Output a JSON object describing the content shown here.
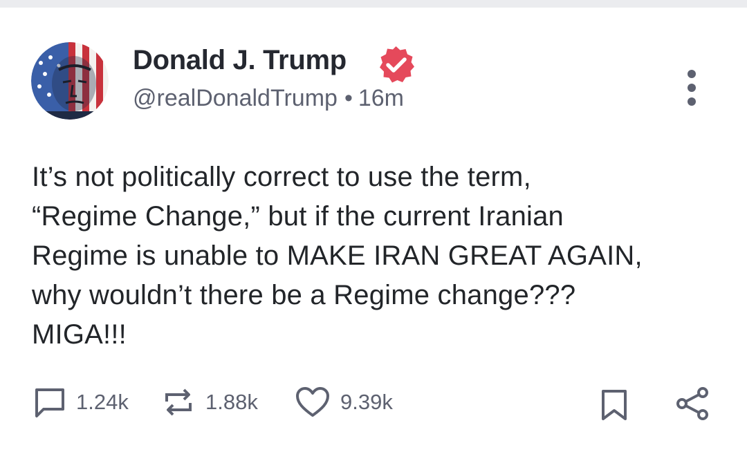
{
  "post": {
    "author": {
      "display_name": "Donald J. Trump",
      "handle": "@realDonaldTrump",
      "verified": true,
      "avatar_icon": "avatar-flag-portrait"
    },
    "separator": "•",
    "time_ago": "16m",
    "text_lines": [
      "It’s not politically correct to use the term,",
      "“Regime Change,” but if the current Iranian",
      "Regime is unable to MAKE IRAN GREAT AGAIN,",
      "why wouldn’t there be a Regime change???",
      "MIGA!!!"
    ],
    "actions": {
      "replies": "1.24k",
      "reposts": "1.88k",
      "likes": "9.39k"
    }
  },
  "icons": {
    "verified": "verified-badge-icon",
    "more": "more-vertical-icon",
    "reply": "comment-icon",
    "repost": "repost-icon",
    "like": "heart-icon",
    "bookmark": "bookmark-icon",
    "share": "share-icon"
  },
  "colors": {
    "verified_badge": "#e5495b",
    "text_primary": "#222529",
    "text_secondary": "#5d6170",
    "divider": "#ebecef"
  }
}
